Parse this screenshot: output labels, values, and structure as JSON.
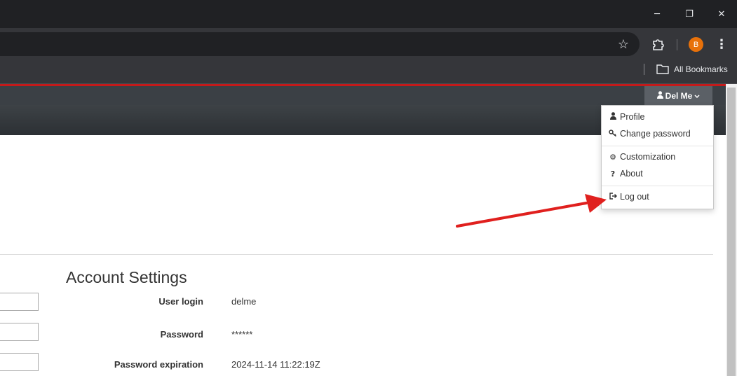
{
  "browser": {
    "window_controls": {
      "minimize": "─",
      "restore": "❐",
      "close": "✕"
    },
    "toolbar": {
      "star_icon": "☆",
      "extensions_icon": "puzzle-icon",
      "profile_initial": "B",
      "menu_icon": "⋮"
    },
    "bookmarks_bar": {
      "all_bookmarks": "All Bookmarks"
    }
  },
  "app": {
    "user_menu": {
      "label": "Del Me",
      "items": [
        {
          "label": "Profile",
          "icon": "user-icon"
        },
        {
          "label": "Change password",
          "icon": "key-icon"
        },
        {
          "label": "Customization",
          "icon": "gear-icon"
        },
        {
          "label": "About",
          "icon": "question-icon"
        },
        {
          "label": "Log out",
          "icon": "sign-out-icon"
        }
      ]
    },
    "account_settings": {
      "title": "Account Settings",
      "rows": [
        {
          "label": "User login",
          "value": "delme"
        },
        {
          "label": "Password",
          "value": "******"
        },
        {
          "label": "Password expiration",
          "value": "2024-11-14 11:22:19Z"
        }
      ]
    }
  },
  "colors": {
    "accent_red": "#c41a1a",
    "nav_dark": "#3b4045",
    "arrow_red": "#e0201e"
  }
}
